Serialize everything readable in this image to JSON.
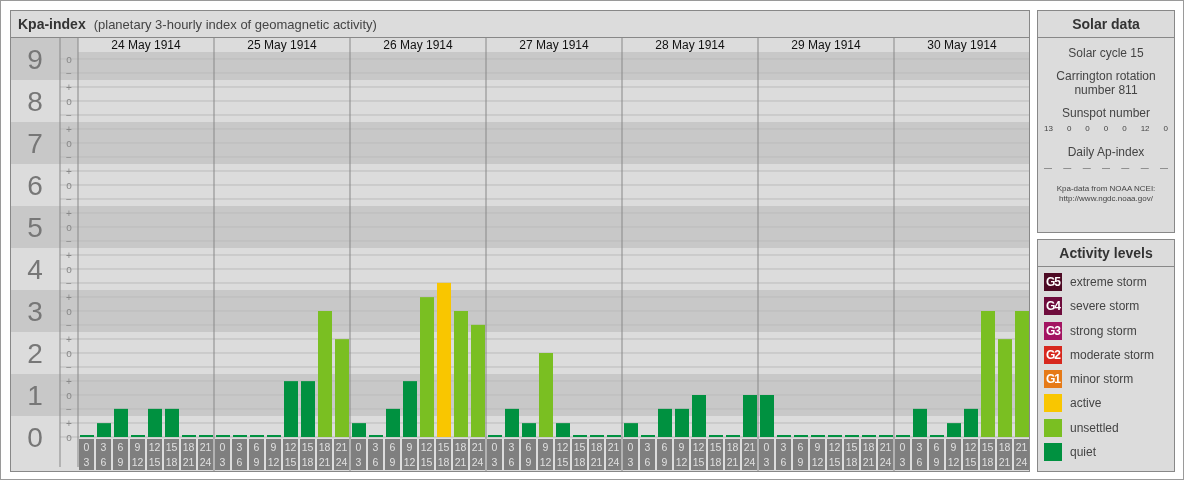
{
  "title": {
    "name": "Kpa-index",
    "subtitle": "(planetary 3-hourly index of geomagnetic activity)"
  },
  "chart": {
    "days": [
      "24 May 1914",
      "25 May 1914",
      "26 May 1914",
      "27 May 1914",
      "28 May 1914",
      "29 May 1914",
      "30 May 1914"
    ],
    "minor_ticks": [
      "o",
      "−",
      "+",
      "o",
      "−",
      "+",
      "o",
      "−",
      "+",
      "o",
      "−",
      "+",
      "o",
      "−",
      "+",
      "o",
      "−",
      "+",
      "o",
      "−",
      "+",
      "o",
      "−",
      "+",
      "o",
      "−",
      "+",
      "o"
    ],
    "chart_data": {
      "type": "bar",
      "ylim": [
        0,
        9
      ],
      "yticks": [
        0,
        1,
        2,
        3,
        4,
        5,
        6,
        7,
        8,
        9
      ],
      "grid": true,
      "categories": [
        "0 3",
        "3 6",
        "6 9",
        "9 12",
        "12 15",
        "15 18",
        "18 21",
        "21 24",
        "0 3",
        "3 6",
        "6 9",
        "9 12",
        "12 15",
        "15 18",
        "18 21",
        "21 24",
        "0 3",
        "3 6",
        "6 9",
        "9 12",
        "12 15",
        "15 18",
        "18 21",
        "21 24",
        "0 3",
        "3 6",
        "6 9",
        "9 12",
        "12 15",
        "15 18",
        "18 21",
        "21 24",
        "0 3",
        "3 6",
        "6 9",
        "9 12",
        "12 15",
        "15 18",
        "18 21",
        "21 24",
        "0 3",
        "3 6",
        "6 9",
        "9 12",
        "12 15",
        "15 18",
        "18 21",
        "21 24",
        "0 3",
        "3 6",
        "6 9",
        "9 12",
        "12 15",
        "15 18",
        "18 21",
        "21 24"
      ],
      "series": [
        {
          "color": "#009140",
          "values": [
            0,
            0.33,
            0.67,
            0,
            0.67,
            0.67,
            0,
            0,
            0,
            0,
            0,
            0,
            1.33,
            1.33,
            null,
            null,
            0.33,
            0,
            0.67,
            1.33,
            null,
            null,
            null,
            null,
            0,
            0.67,
            0.33,
            null,
            0.33,
            0,
            0,
            0,
            0.33,
            0,
            0.67,
            0.67,
            1,
            0,
            0,
            1,
            1,
            0,
            0,
            0,
            0,
            0,
            0,
            0,
            0,
            0.67,
            0,
            0.33,
            0.67,
            null,
            null,
            null
          ]
        },
        {
          "color": "#7abf22",
          "values": [
            null,
            null,
            null,
            null,
            null,
            null,
            null,
            null,
            null,
            null,
            null,
            null,
            null,
            null,
            3,
            2.33,
            null,
            null,
            null,
            null,
            3.33,
            null,
            3,
            2.67,
            null,
            null,
            null,
            2,
            null,
            null,
            null,
            null,
            null,
            null,
            null,
            null,
            null,
            null,
            null,
            null,
            null,
            null,
            null,
            null,
            null,
            null,
            null,
            null,
            null,
            null,
            null,
            null,
            null,
            3,
            2.33,
            3
          ]
        },
        {
          "color": "#f9c600",
          "values": [
            null,
            null,
            null,
            null,
            null,
            null,
            null,
            null,
            null,
            null,
            null,
            null,
            null,
            null,
            null,
            null,
            null,
            null,
            null,
            null,
            null,
            3.67,
            null,
            null,
            null,
            null,
            null,
            null,
            null,
            null,
            null,
            null,
            null,
            null,
            null,
            null,
            null,
            null,
            null,
            null,
            null,
            null,
            null,
            null,
            null,
            null,
            null,
            null,
            null,
            null,
            null,
            null,
            null,
            null,
            null,
            null
          ]
        }
      ]
    }
  },
  "solar_data": {
    "title": "Solar data",
    "solar_cycle": "Solar cycle 15",
    "carrington": "Carrington rotation number 811",
    "sunspot_label": "Sunspot number",
    "sunspots": [
      "13",
      "0",
      "0",
      "0",
      "0",
      "12",
      "0"
    ],
    "ap_label": "Daily Ap-index",
    "ap_values": [
      "—",
      "—",
      "—",
      "—",
      "—",
      "—",
      "—"
    ],
    "source": "Kpa-data from NOAA NCEI:",
    "source_url": "http://www.ngdc.noaa.gov/"
  },
  "legend": {
    "title": "Activity levels",
    "items": [
      {
        "badge": "G5",
        "label": "extreme storm",
        "color": "#4d0a24"
      },
      {
        "badge": "G4",
        "label": "severe storm",
        "color": "#6e0c3c"
      },
      {
        "badge": "G3",
        "label": "strong storm",
        "color": "#a31462"
      },
      {
        "badge": "G2",
        "label": "moderate storm",
        "color": "#d7281e"
      },
      {
        "badge": "G1",
        "label": "minor storm",
        "color": "#e67a17"
      },
      {
        "label": "active",
        "color": "#f9c600"
      },
      {
        "label": "unsettled",
        "color": "#7abf22"
      },
      {
        "label": "quiet",
        "color": "#009140"
      }
    ]
  }
}
